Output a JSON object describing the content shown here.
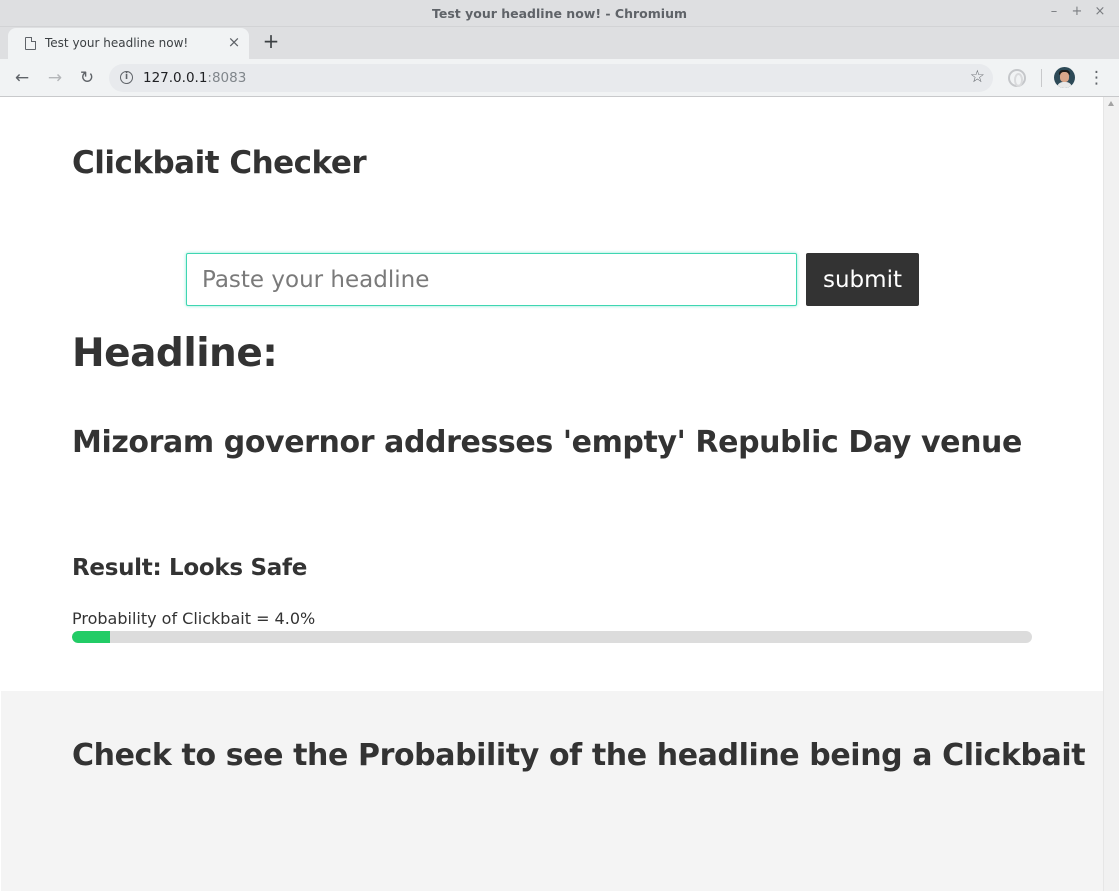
{
  "window": {
    "title": "Test your headline now! - Chromium",
    "controls": {
      "minimize": "–",
      "maximize": "+",
      "close": "×"
    }
  },
  "tabs": [
    {
      "title": "Test your headline now!",
      "close": "×"
    }
  ],
  "new_tab": "+",
  "toolbar": {
    "back": "←",
    "forward": "→",
    "reload": "↻",
    "info": "i",
    "url_host": "127.0.0.1",
    "url_port": ":8083",
    "bookmark": "☆",
    "menu": "⋮"
  },
  "page": {
    "app_title": "Clickbait Checker",
    "input": {
      "placeholder": "Paste your headline",
      "value": ""
    },
    "submit_label": "submit",
    "headline_label": "Headline:",
    "headline_text": "Mizoram governor addresses 'empty' Republic Day venue",
    "result_text": "Result: Looks Safe",
    "probability_text": "Probability of Clickbait = 4.0%",
    "probability_value": 0.04,
    "footer_text": "Check to see the Probability of the headline being a Clickbait"
  },
  "colors": {
    "accent_input_border": "#3fd6b2",
    "progress_fill": "#22cc66",
    "progress_track": "#dcdcdc",
    "submit_bg": "#333333",
    "text": "#333333",
    "footer_bg": "#f4f4f4"
  },
  "icons": {
    "tab_favicon": "page-icon",
    "info": "info-icon",
    "bookmark": "star-icon",
    "extension": "extension-icon",
    "profile": "avatar"
  }
}
